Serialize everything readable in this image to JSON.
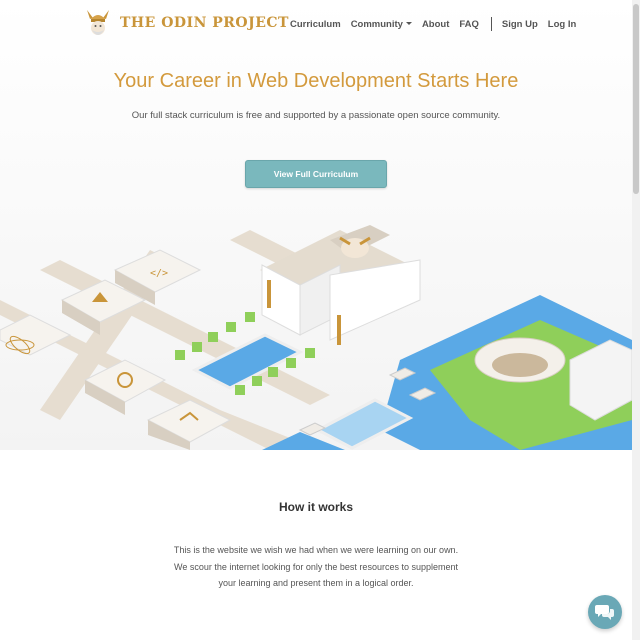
{
  "brand": {
    "name": "THE ODIN PROJECT",
    "logo_icon": "viking-helmet-icon",
    "accent": "#c9953a"
  },
  "nav": {
    "curriculum": "Curriculum",
    "community": "Community",
    "about": "About",
    "faq": "FAQ",
    "sign_up": "Sign Up",
    "log_in": "Log In"
  },
  "hero": {
    "title": "Your Career in Web Development Starts Here",
    "subtitle": "Our full stack curriculum is free and supported by a passionate open source community.",
    "cta_label": "View Full Curriculum",
    "illustration_icon": "isometric-city-icon"
  },
  "how_it_works": {
    "title": "How it works",
    "body": "This is the website we wish we had when we were learning on our own. We scour the internet looking for only the best resources to supplement your learning and present them in a logical order."
  },
  "chat": {
    "icon": "chat-bubbles-icon"
  },
  "colors": {
    "title": "#d39a3d",
    "button": "#7ab8bd",
    "water": "#5aa9e6",
    "grass": "#8fcf5a",
    "chat": "#6aa8b6"
  }
}
